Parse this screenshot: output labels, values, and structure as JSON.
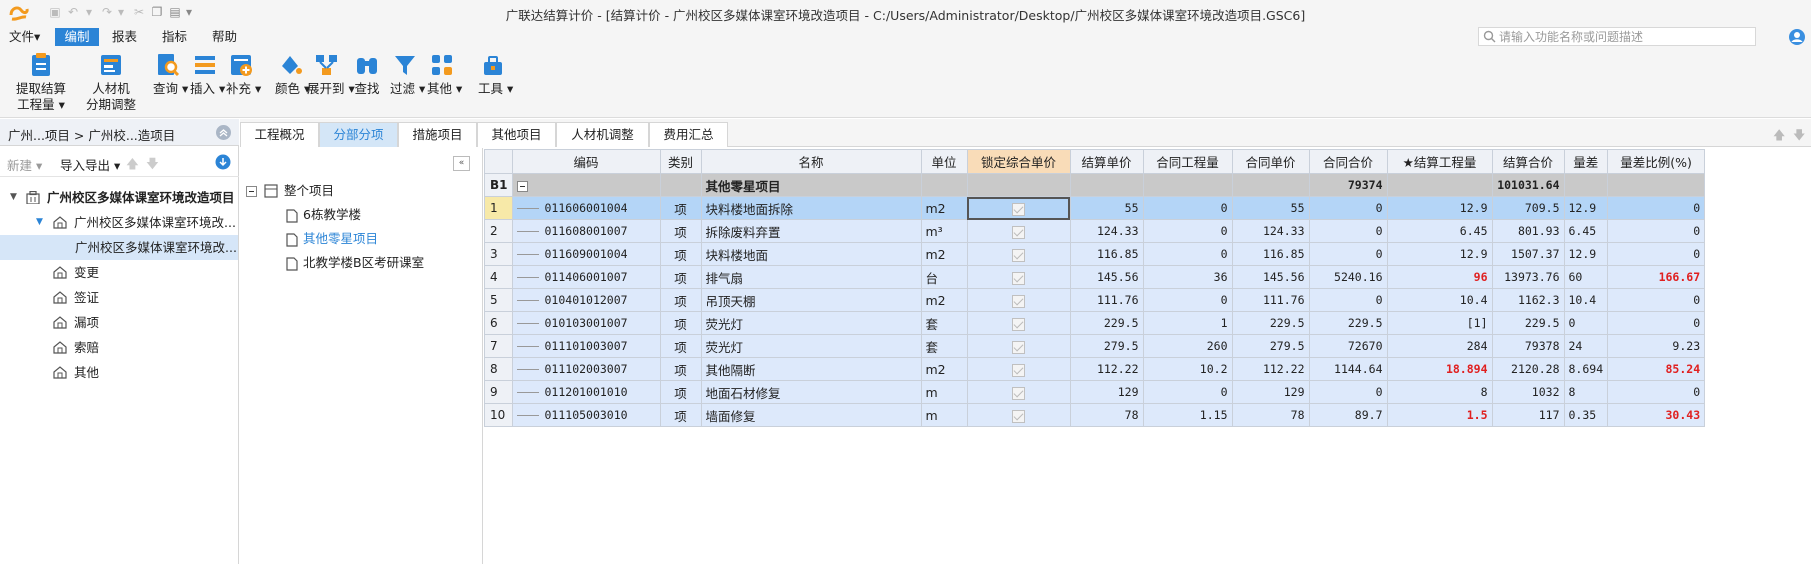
{
  "window": {
    "title": "广联达结算计价 - [结算计价 - 广州校区多媒体课室环境改造项目 - C:/Users/Administrator/Desktop/广州校区多媒体课室环境改造项目.GSC6]"
  },
  "menu": [
    "文件▾",
    "编制",
    "报表",
    "指标",
    "帮助"
  ],
  "search": {
    "placeholder": "请输入功能名称或问题描述"
  },
  "ribbon": [
    {
      "label": "提取结算\n工程量 ▾",
      "icon": "extract-quantity-icon"
    },
    {
      "label": "人材机\n分期调整",
      "icon": "material-adjust-icon"
    },
    {
      "label": "查询 ▾",
      "icon": "query-icon"
    },
    {
      "label": "插入 ▾",
      "icon": "insert-icon"
    },
    {
      "label": "补充 ▾",
      "icon": "supplement-icon"
    },
    {
      "label": "颜色 ▾",
      "icon": "color-icon"
    },
    {
      "label": "展开到 ▾",
      "icon": "expand-icon"
    },
    {
      "label": "查找",
      "icon": "binoculars-icon"
    },
    {
      "label": "过滤 ▾",
      "icon": "filter-icon"
    },
    {
      "label": "其他 ▾",
      "icon": "other-icon"
    },
    {
      "label": "工具 ▾",
      "icon": "tools-icon"
    }
  ],
  "left": {
    "breadcrumb": "广州...项目 > 广州校...造项目",
    "new_label": "新建 ▾",
    "import_label": "导入导出 ▾",
    "tree": [
      {
        "label": "广州校区多媒体课室环境改造项目",
        "level": 0
      },
      {
        "label": "广州校区多媒体课室环境改...",
        "level": 1
      },
      {
        "label": "广州校区多媒体课室环境改...",
        "level": 2
      },
      {
        "label": "变更",
        "level": 1
      },
      {
        "label": "签证",
        "level": 1
      },
      {
        "label": "漏项",
        "level": 1
      },
      {
        "label": "索赔",
        "level": 1
      },
      {
        "label": "其他",
        "level": 1
      }
    ]
  },
  "tabs": [
    "工程概况",
    "分部分项",
    "措施项目",
    "其他项目",
    "人材机调整",
    "费用汇总"
  ],
  "subtree": {
    "root": "整个项目",
    "items": [
      "6栋教学楼",
      "其他零星项目",
      "北教学楼B区考研课室"
    ]
  },
  "grid": {
    "headers": [
      "编码",
      "类别",
      "名称",
      "单位",
      "锁定综合单价",
      "结算单价",
      "合同工程量",
      "合同单价",
      "合同合价",
      "★结算工程量",
      "结算合价",
      "量差",
      "量差比例(%)"
    ],
    "group": {
      "rn": "B1",
      "name": "其他零星项目",
      "contract_total": "79374",
      "settle_total": "101031.64"
    },
    "rows": [
      [
        "1",
        "011606001004",
        "项",
        "块料楼地面拆除",
        "m2",
        "55",
        "0",
        "55",
        "0",
        "12.9",
        "709.5",
        "12.9",
        "0"
      ],
      [
        "2",
        "011608001007",
        "项",
        "拆除废料弃置",
        "m³",
        "124.33",
        "0",
        "124.33",
        "0",
        "6.45",
        "801.93",
        "6.45",
        "0"
      ],
      [
        "3",
        "011609001004",
        "项",
        "块料楼地面",
        "m2",
        "116.85",
        "0",
        "116.85",
        "0",
        "12.9",
        "1507.37",
        "12.9",
        "0"
      ],
      [
        "4",
        "011406001007",
        "项",
        "排气扇",
        "台",
        "145.56",
        "36",
        "145.56",
        "5240.16",
        "96",
        "13973.76",
        "60",
        "166.67"
      ],
      [
        "5",
        "010401012007",
        "项",
        "吊顶天棚",
        "m2",
        "111.76",
        "0",
        "111.76",
        "0",
        "10.4",
        "1162.3",
        "10.4",
        "0"
      ],
      [
        "6",
        "010103001007",
        "项",
        "荧光灯",
        "套",
        "229.5",
        "1",
        "229.5",
        "229.5",
        "[1]",
        "229.5",
        "0",
        "0"
      ],
      [
        "7",
        "011101003007",
        "项",
        "荧光灯",
        "套",
        "279.5",
        "260",
        "279.5",
        "72670",
        "284",
        "79378",
        "24",
        "9.23"
      ],
      [
        "8",
        "011102003007",
        "项",
        "其他隔断",
        "m2",
        "112.22",
        "10.2",
        "112.22",
        "1144.64",
        "18.894",
        "2120.28",
        "8.694",
        "85.24"
      ],
      [
        "9",
        "011201001010",
        "项",
        "地面石材修复",
        "m",
        "129",
        "0",
        "129",
        "0",
        "8",
        "1032",
        "8",
        "0"
      ],
      [
        "10",
        "011105003010",
        "项",
        "墙面修复",
        "m",
        "78",
        "1.15",
        "78",
        "89.7",
        "1.5",
        "117",
        "0.35",
        "30.43"
      ]
    ],
    "red_settle_qty_rows": [
      4,
      8,
      10
    ],
    "red_ratio_rows": [
      4,
      8,
      10
    ]
  },
  "colors": {
    "accent": "#2b84d6",
    "selected_row": "#b4d5f7",
    "row": "#dde9fb",
    "group_row": "#c9c9c9",
    "lock_header": "#f9dcb8",
    "warning": "#e02020"
  }
}
